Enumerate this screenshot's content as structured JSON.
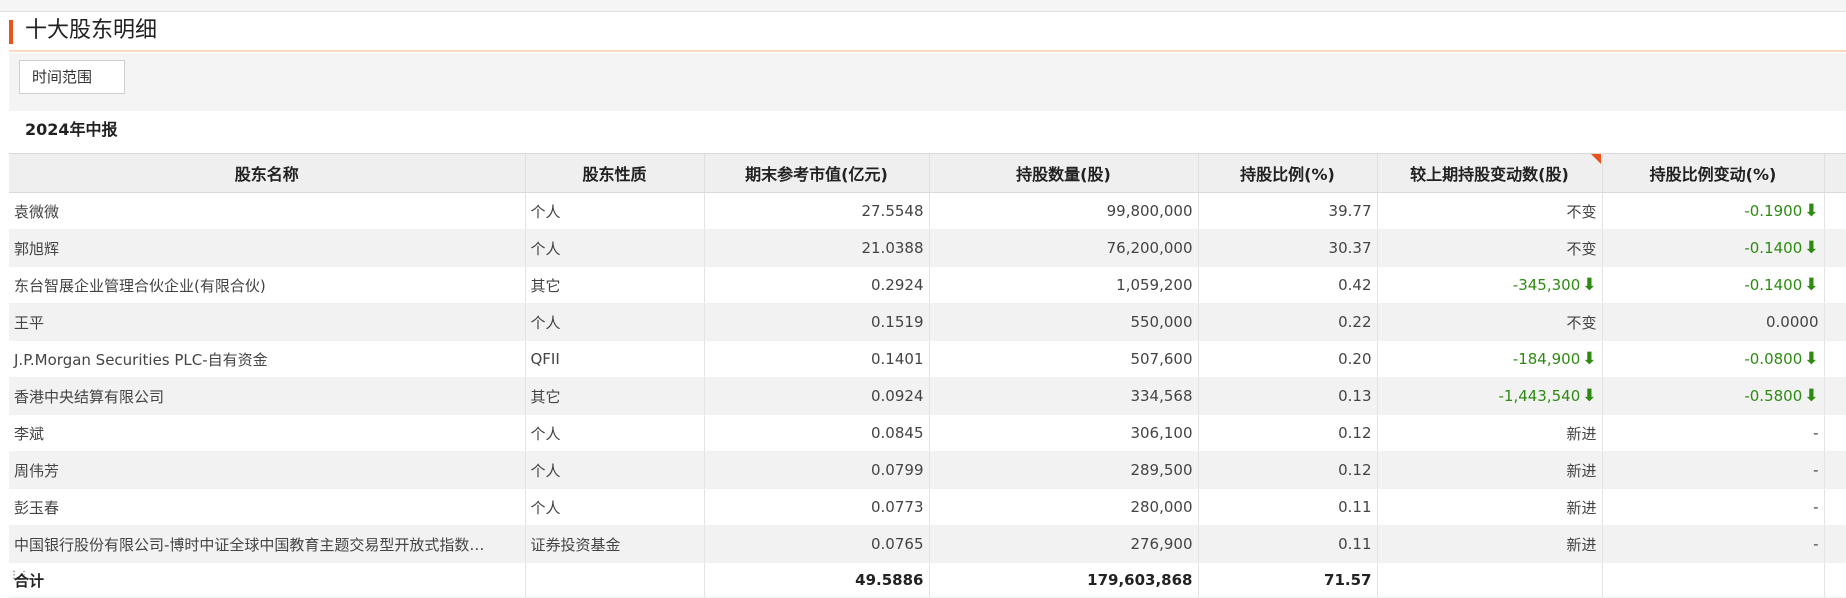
{
  "header": {
    "title": "十大股东明细"
  },
  "filter": {
    "button_label": "时间范围"
  },
  "period": "2024年中报",
  "columns": [
    "股东名称",
    "股东性质",
    "期末参考市值(亿元)",
    "持股数量(股)",
    "持股比例(%)",
    "较上期持股变动数(股)",
    "持股比例变动(%)"
  ],
  "rows": [
    {
      "name": "袁微微",
      "type": "个人",
      "market_value": "27.5548",
      "shares": "99,800,000",
      "ratio": "39.77",
      "share_change": "不变",
      "ratio_change": "-0.1900"
    },
    {
      "name": "郭旭辉",
      "type": "个人",
      "market_value": "21.0388",
      "shares": "76,200,000",
      "ratio": "30.37",
      "share_change": "不变",
      "ratio_change": "-0.1400"
    },
    {
      "name": "东台智展企业管理合伙企业(有限合伙)",
      "type": "其它",
      "market_value": "0.2924",
      "shares": "1,059,200",
      "ratio": "0.42",
      "share_change": "-345,300",
      "ratio_change": "-0.1400"
    },
    {
      "name": "王平",
      "type": "个人",
      "market_value": "0.1519",
      "shares": "550,000",
      "ratio": "0.22",
      "share_change": "不变",
      "ratio_change": "0.0000"
    },
    {
      "name": "J.P.Morgan Securities PLC-自有资金",
      "type": "QFII",
      "market_value": "0.1401",
      "shares": "507,600",
      "ratio": "0.20",
      "share_change": "-184,900",
      "ratio_change": "-0.0800"
    },
    {
      "name": "香港中央结算有限公司",
      "type": "其它",
      "market_value": "0.0924",
      "shares": "334,568",
      "ratio": "0.13",
      "share_change": "-1,443,540",
      "ratio_change": "-0.5800"
    },
    {
      "name": "李斌",
      "type": "个人",
      "market_value": "0.0845",
      "shares": "306,100",
      "ratio": "0.12",
      "share_change": "新进",
      "ratio_change": "-"
    },
    {
      "name": "周伟芳",
      "type": "个人",
      "market_value": "0.0799",
      "shares": "289,500",
      "ratio": "0.12",
      "share_change": "新进",
      "ratio_change": "-"
    },
    {
      "name": "彭玉春",
      "type": "个人",
      "market_value": "0.0773",
      "shares": "280,000",
      "ratio": "0.11",
      "share_change": "新进",
      "ratio_change": "-"
    },
    {
      "name": "中国银行股份有限公司-博时中证全球中国教育主题交易型开放式指数…",
      "type": "证券投资基金",
      "market_value": "0.0765",
      "shares": "276,900",
      "ratio": "0.11",
      "share_change": "新进",
      "ratio_change": "-"
    }
  ],
  "total": {
    "label": "合计",
    "market_value": "49.5886",
    "shares": "179,603,868",
    "ratio": "71.57"
  },
  "colors": {
    "accent": "#e8541c",
    "down": "#2e8b12"
  },
  "icons": {
    "decrease": "arrow-down-icon"
  }
}
